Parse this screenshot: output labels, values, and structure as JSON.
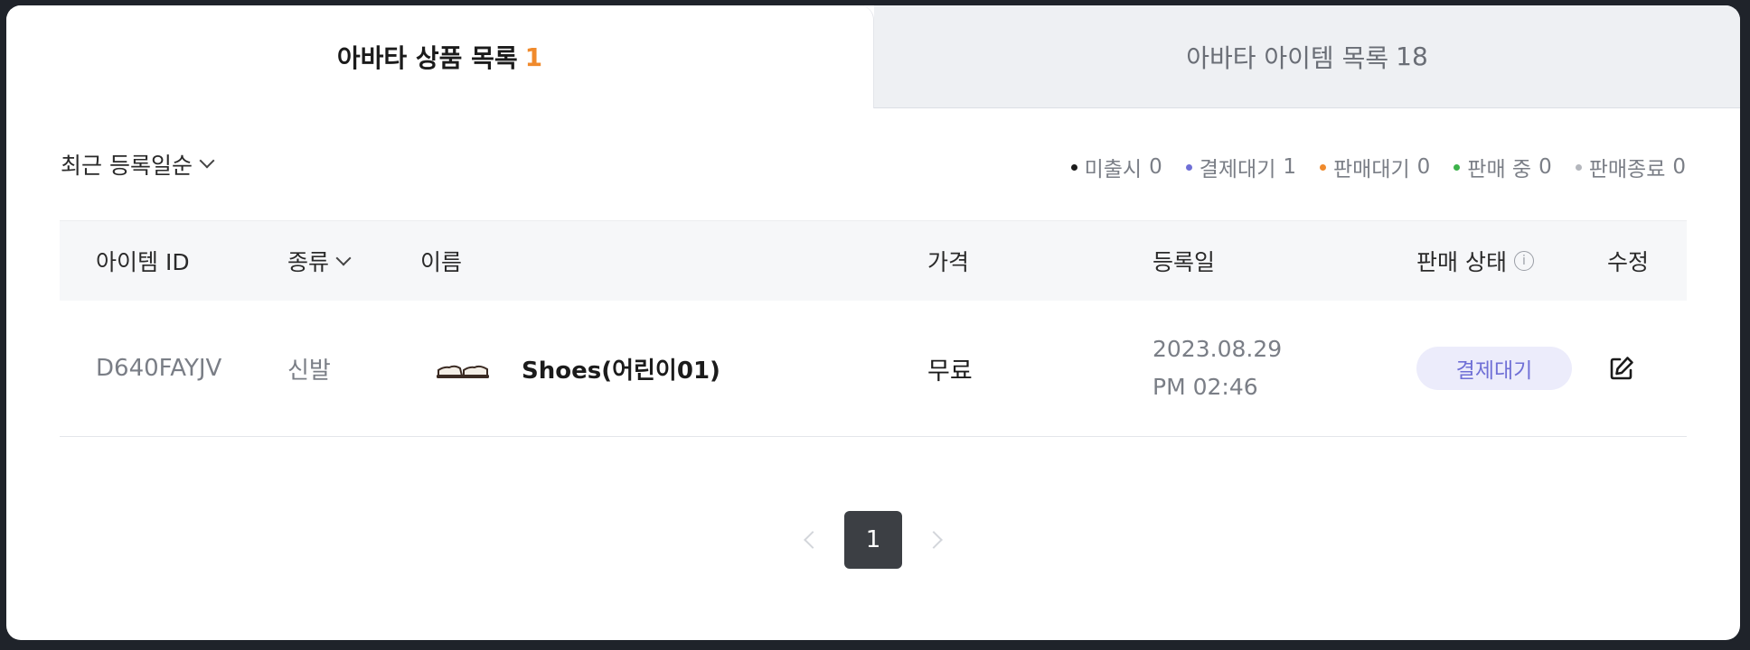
{
  "tabs": [
    {
      "label": "아바타 상품 목록",
      "count": "1"
    },
    {
      "label": "아바타 아이템 목록",
      "count": "18"
    }
  ],
  "sort": {
    "label": "최근 등록일순"
  },
  "legend": [
    {
      "label": "미출시",
      "count": "0",
      "color": "#1b1b1b"
    },
    {
      "label": "결제대기",
      "count": "1",
      "color": "#6f6fd6"
    },
    {
      "label": "판매대기",
      "count": "0",
      "color": "#f08a2c"
    },
    {
      "label": "판매 중",
      "count": "0",
      "color": "#3cb24a"
    },
    {
      "label": "판매종료",
      "count": "0",
      "color": "#b4b7bd"
    }
  ],
  "table": {
    "headers": {
      "id": "아이템 ID",
      "type": "종류",
      "name": "이름",
      "price": "가격",
      "date": "등록일",
      "status": "판매 상태",
      "edit": "수정"
    },
    "rows": [
      {
        "id": "D640FAYJV",
        "type": "신발",
        "name": "Shoes(어린이01)",
        "price": "무료",
        "date": "2023.08.29",
        "time": "PM 02:46",
        "status": "결제대기",
        "status_color": "#6f6fd6"
      }
    ]
  },
  "pagination": {
    "current": "1"
  }
}
